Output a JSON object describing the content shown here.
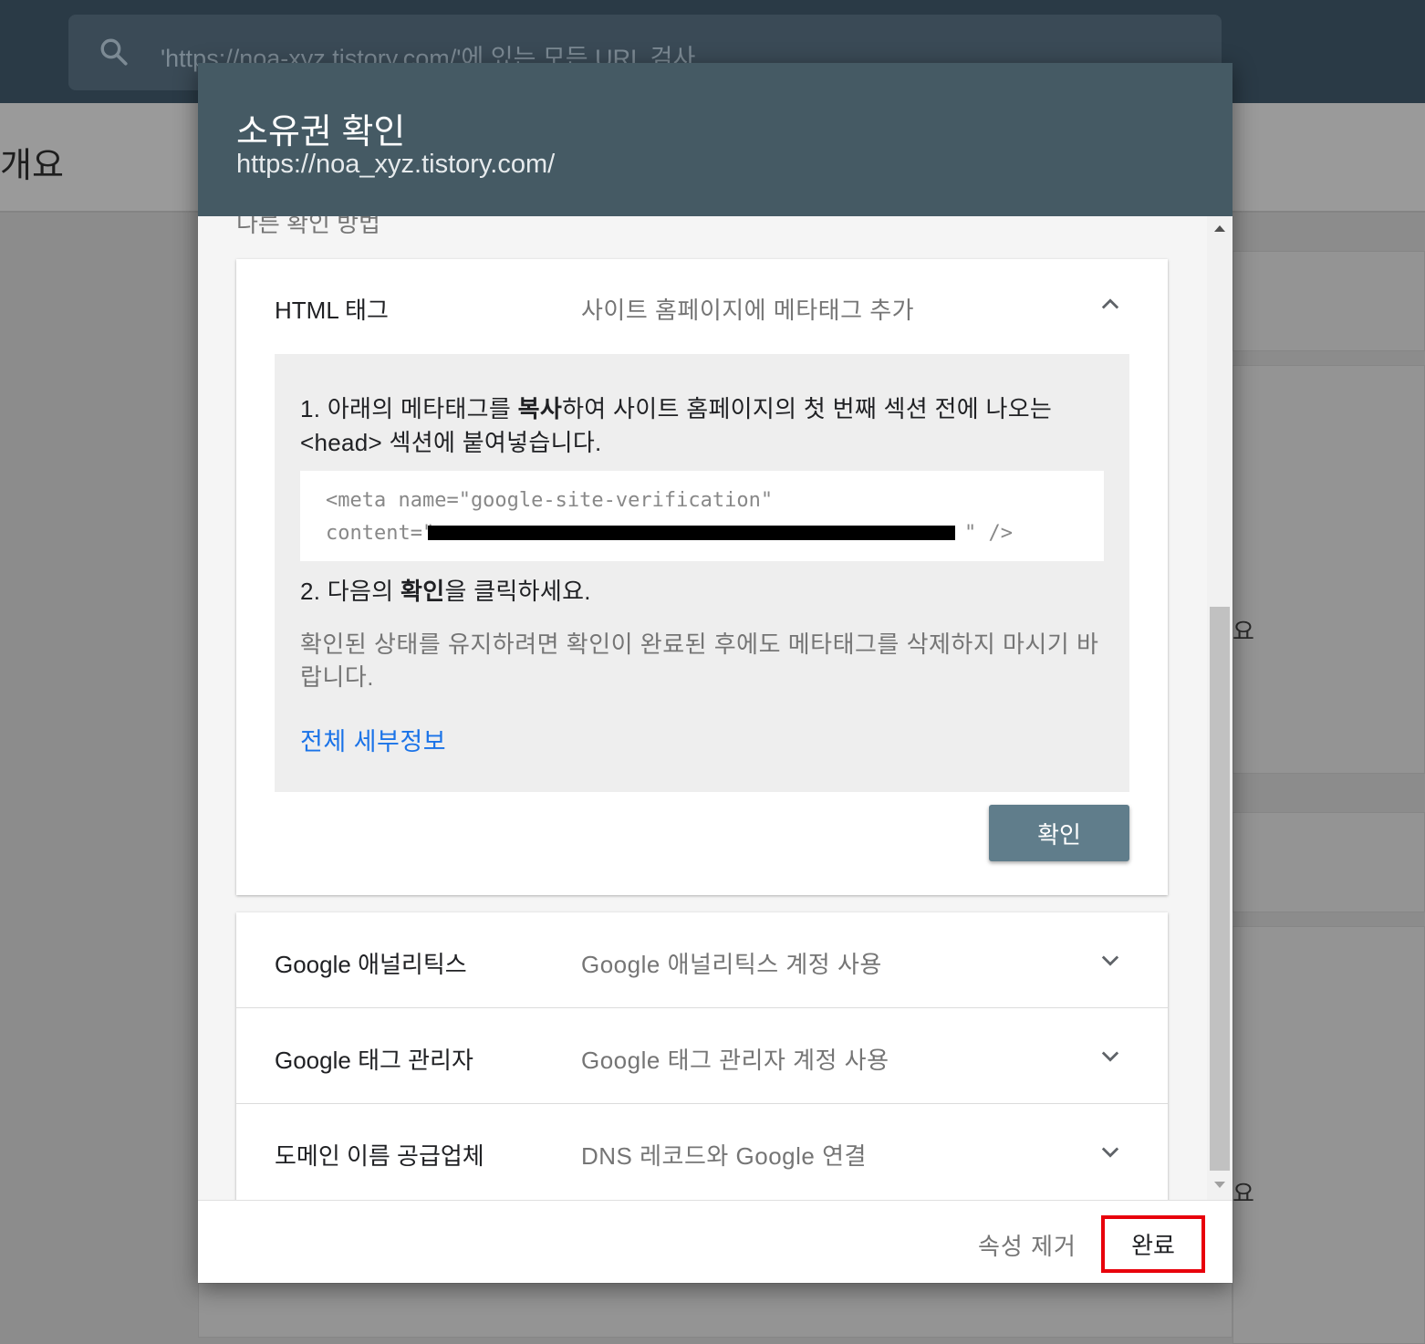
{
  "background": {
    "search_placeholder": "'https://noa-xyz.tistory.com/'에 있는 모든 URL 검사",
    "page_title": "개요",
    "side_text_1": "요",
    "side_text_2": "요"
  },
  "dialog": {
    "title": "소유권 확인",
    "subtitle": "https://noa_xyz.tistory.com/",
    "section_peek": "다른 확인 방법",
    "html_tag": {
      "name": "HTML 태그",
      "description": "사이트 홈페이지에 메타태그 추가",
      "step1_num": "1. ",
      "step1_pre": "아래의 메타태그를 ",
      "step1_bold": "복사",
      "step1_post": "하여 사이트 홈페이지의 첫 번째 섹션 전에 나오는 <head> 섹션에 붙여넣습니다.",
      "code_line1": "<meta name=\"google-site-verification\"",
      "code_line2_start": "content=\"",
      "code_line2_end": "\" />",
      "step2_pre": "2. 다음의 ",
      "step2_bold": "확인",
      "step2_post": "을 클릭하세요.",
      "note": "확인된 상태를 유지하려면 확인이 완료된 후에도 메타태그를 삭제하지 마시기 바랍니다.",
      "details_link": "전체 세부정보",
      "confirm_button": "확인"
    },
    "methods": [
      {
        "name": "Google 애널리틱스",
        "description": "Google 애널리틱스 계정 사용"
      },
      {
        "name": "Google 태그 관리자",
        "description": "Google 태그 관리자 계정 사용"
      },
      {
        "name": "도메인 이름 공급업체",
        "description": "DNS 레코드와 Google 연결"
      }
    ],
    "footer": {
      "remove_button": "속성 제거",
      "done_button": "완료"
    }
  },
  "colors": {
    "header_bg": "#455a64",
    "confirm_button_bg": "#607d8b",
    "link": "#1a73e8",
    "highlight_border": "#e8000b"
  },
  "icons": {
    "search": "search-icon",
    "collapse": "chevron-up-icon",
    "expand": "chevron-down-icon"
  }
}
